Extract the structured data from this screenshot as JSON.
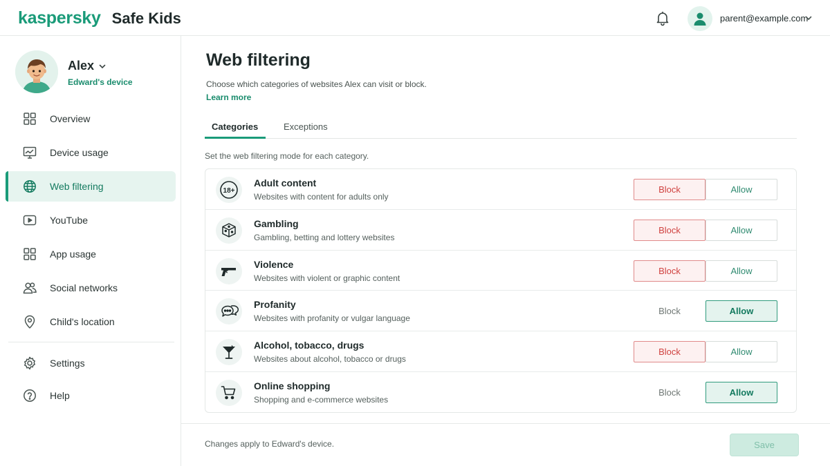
{
  "header": {
    "brand": "kaspersky",
    "product": "Safe Kids",
    "user_email": "parent@example.com"
  },
  "child": {
    "name": "Alex",
    "device": "Edward's device"
  },
  "nav": {
    "items": [
      {
        "label": "Overview",
        "icon": "grid-icon"
      },
      {
        "label": "Device usage",
        "icon": "monitor-icon"
      },
      {
        "label": "Web filtering",
        "icon": "globe-icon",
        "active": true
      },
      {
        "label": "YouTube",
        "icon": "play-icon"
      },
      {
        "label": "App usage",
        "icon": "apps-icon"
      },
      {
        "label": "Social networks",
        "icon": "people-icon"
      },
      {
        "label": "Child's location",
        "icon": "location-pin-icon"
      }
    ],
    "bottom": [
      {
        "label": "Settings",
        "icon": "gear-icon"
      },
      {
        "label": "Help",
        "icon": "help-icon"
      }
    ]
  },
  "main": {
    "title": "Web filtering",
    "description": "Choose which categories of websites Alex can visit or block.",
    "learn_more": "Learn more",
    "tabs": [
      {
        "label": "Categories",
        "active": true
      },
      {
        "label": "Exceptions",
        "active": false
      }
    ],
    "mode_hint": "Set the web filtering mode for each category.",
    "block_label": "Block",
    "allow_label": "Allow",
    "categories": [
      {
        "title": "Adult content",
        "subtitle": "Websites with content for adults only",
        "icon": "18-plus-icon",
        "mode": "Block"
      },
      {
        "title": "Gambling",
        "subtitle": "Gambling, betting and lottery websites",
        "icon": "dice-icon",
        "mode": "Block"
      },
      {
        "title": "Violence",
        "subtitle": "Websites with violent or graphic content",
        "icon": "pistol-icon",
        "mode": "Block"
      },
      {
        "title": "Profanity",
        "subtitle": "Websites with profanity or vulgar language",
        "icon": "speech-bubbles-icon",
        "mode": "Allow"
      },
      {
        "title": "Alcohol, tobacco, drugs",
        "subtitle": "Websites about alcohol, tobacco or drugs",
        "icon": "cocktail-glass-icon",
        "mode": "Block"
      },
      {
        "title": "Online shopping",
        "subtitle": "Shopping and e-commerce websites",
        "icon": "shopping-cart-icon",
        "mode": "Allow"
      }
    ]
  },
  "footer": {
    "note": "Changes apply to Edward's device.",
    "save_label": "Save"
  },
  "colors": {
    "brand": "#1a9b79",
    "block_active": "#d0413f",
    "allow_active": "#137a5f"
  }
}
